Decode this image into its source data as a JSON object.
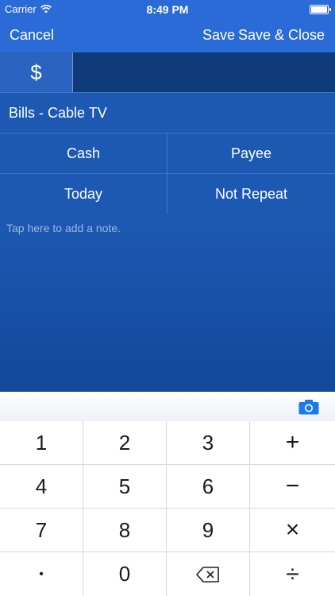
{
  "status_bar": {
    "carrier": "Carrier",
    "time": "8:49 PM"
  },
  "nav": {
    "cancel_label": "Cancel",
    "save_label": "Save",
    "save_close_label": "Save & Close"
  },
  "amount": {
    "currency_symbol": "$",
    "value": ""
  },
  "category": {
    "label": "Bills - Cable TV"
  },
  "row2": {
    "account": "Cash",
    "payee": "Payee"
  },
  "row3": {
    "date": "Today",
    "repeat": "Not Repeat"
  },
  "note": {
    "placeholder": "Tap here to add a note."
  },
  "keypad": {
    "k1": "1",
    "k2": "2",
    "k3": "3",
    "plus": "+",
    "k4": "4",
    "k5": "5",
    "k6": "6",
    "minus": "−",
    "k7": "7",
    "k8": "8",
    "k9": "9",
    "multiply": "×",
    "dot": "•",
    "k0": "0",
    "divide": "÷"
  },
  "colors": {
    "nav_blue": "#2a6bd8",
    "panel_blue": "#1d59b3",
    "camera_blue": "#1a7be8"
  }
}
